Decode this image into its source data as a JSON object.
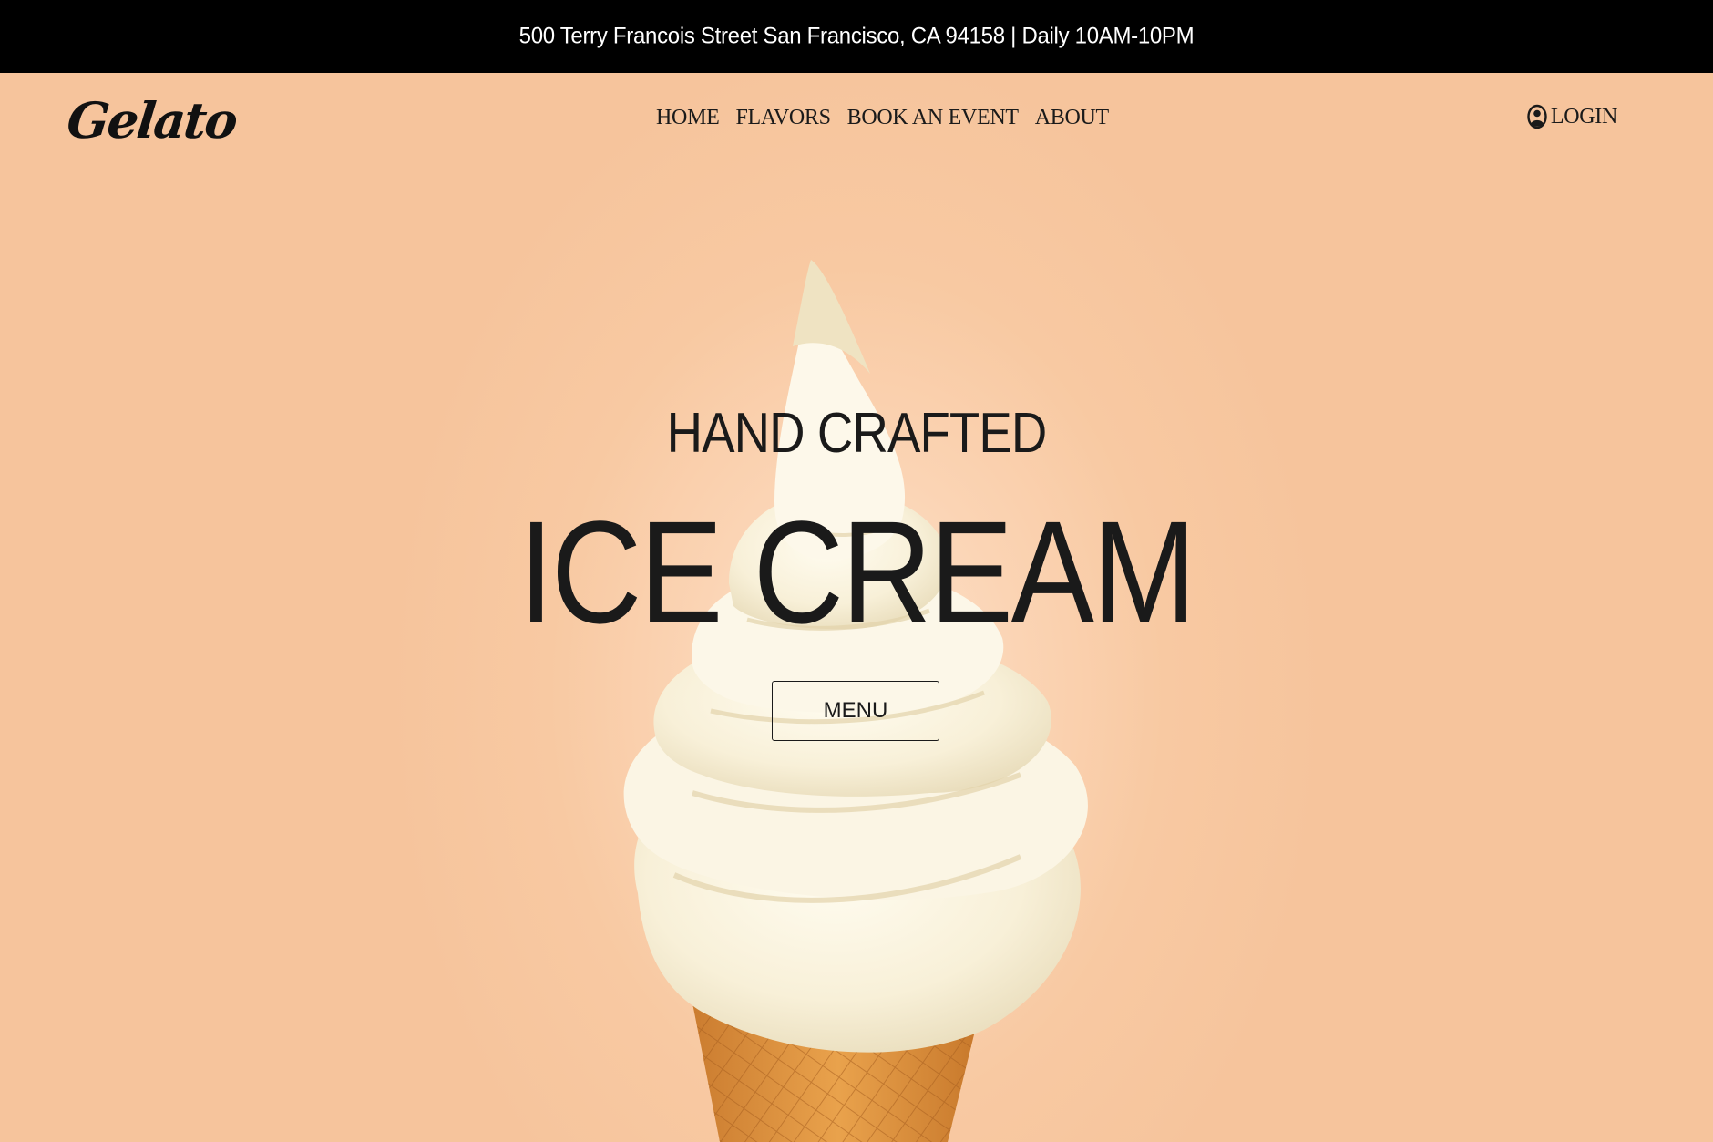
{
  "announcement": {
    "text": "500 Terry Francois Street San Francisco, CA 94158 | Daily 10AM-10PM"
  },
  "header": {
    "logo": "Gelato",
    "nav": [
      {
        "label": "HOME"
      },
      {
        "label": "FLAVORS"
      },
      {
        "label": "BOOK AN EVENT"
      },
      {
        "label": "ABOUT"
      }
    ],
    "login_label": "LOGIN"
  },
  "hero": {
    "subtitle": "HAND CRAFTED",
    "title": "ICE CREAM",
    "cta_label": "MENU",
    "image": "soft-serve-ice-cream-cone"
  },
  "colors": {
    "announcement_bg": "#000000",
    "announcement_text": "#ffffff",
    "hero_bg": "#f6c49c",
    "text": "#1a1a1a"
  },
  "icons": {
    "login": "user-circle-icon"
  }
}
